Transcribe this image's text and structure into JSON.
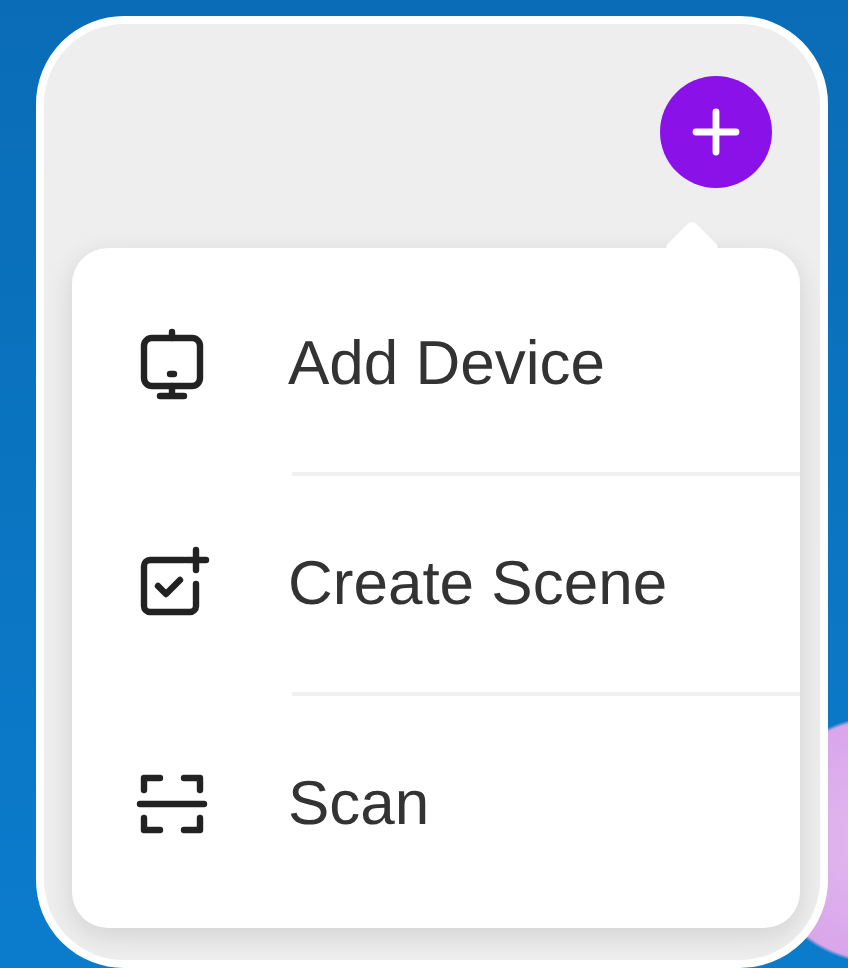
{
  "menu": {
    "items": [
      {
        "kind": "device",
        "label": "Add Device"
      },
      {
        "kind": "scene",
        "label": "Create Scene"
      },
      {
        "kind": "scan",
        "label": "Scan"
      }
    ]
  }
}
